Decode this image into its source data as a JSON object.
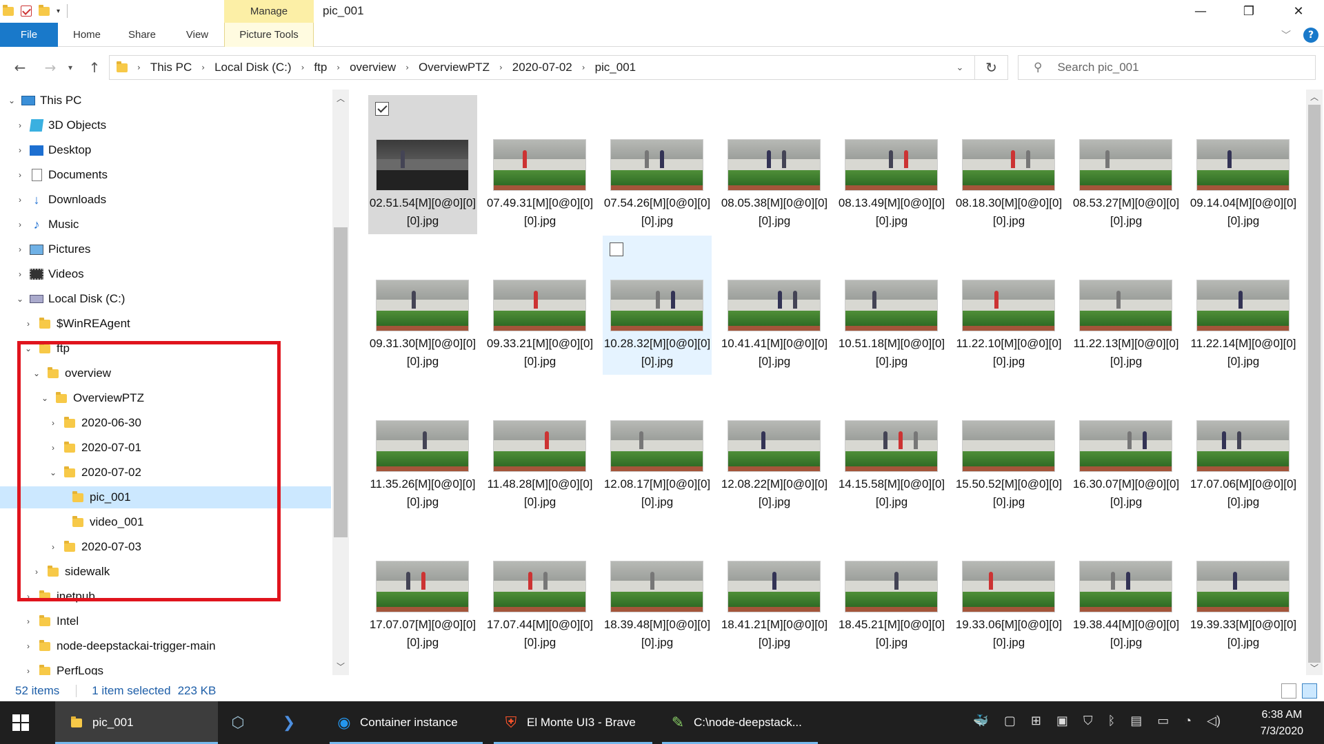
{
  "window": {
    "title": "pic_001",
    "manage_tab": "Manage",
    "tabs": [
      "File",
      "Home",
      "Share",
      "View",
      "Picture Tools"
    ],
    "help": "?"
  },
  "address": {
    "segments": [
      "This PC",
      "Local Disk (C:)",
      "ftp",
      "overview",
      "OverviewPTZ",
      "2020-07-02",
      "pic_001"
    ]
  },
  "search": {
    "placeholder": "Search pic_001"
  },
  "tree": [
    {
      "label": "This PC",
      "icon": "computer-icon",
      "indent": 0,
      "expand": "open"
    },
    {
      "label": "3D Objects",
      "icon": "cube-icon",
      "indent": 1,
      "expand": "closed"
    },
    {
      "label": "Desktop",
      "icon": "desktop-icon",
      "indent": 1,
      "expand": "closed"
    },
    {
      "label": "Documents",
      "icon": "document-icon",
      "indent": 1,
      "expand": "closed"
    },
    {
      "label": "Downloads",
      "icon": "download-icon",
      "indent": 1,
      "expand": "closed"
    },
    {
      "label": "Music",
      "icon": "music-icon",
      "indent": 1,
      "expand": "closed"
    },
    {
      "label": "Pictures",
      "icon": "pictures-icon",
      "indent": 1,
      "expand": "closed"
    },
    {
      "label": "Videos",
      "icon": "videos-icon",
      "indent": 1,
      "expand": "closed"
    },
    {
      "label": "Local Disk (C:)",
      "icon": "disk-icon",
      "indent": 1,
      "expand": "open"
    },
    {
      "label": "$WinREAgent",
      "icon": "folder-icon",
      "indent": 2,
      "expand": "closed"
    },
    {
      "label": "ftp",
      "icon": "folder-icon",
      "indent": 2,
      "expand": "open"
    },
    {
      "label": "overview",
      "icon": "folder-icon",
      "indent": 3,
      "expand": "open"
    },
    {
      "label": "OverviewPTZ",
      "icon": "folder-icon",
      "indent": 4,
      "expand": "open"
    },
    {
      "label": "2020-06-30",
      "icon": "folder-icon",
      "indent": 5,
      "expand": "closed"
    },
    {
      "label": "2020-07-01",
      "icon": "folder-icon",
      "indent": 5,
      "expand": "closed"
    },
    {
      "label": "2020-07-02",
      "icon": "folder-icon",
      "indent": 5,
      "expand": "open"
    },
    {
      "label": "pic_001",
      "icon": "folder-icon",
      "indent": 6,
      "expand": "none",
      "selected": true
    },
    {
      "label": "video_001",
      "icon": "folder-icon",
      "indent": 6,
      "expand": "none"
    },
    {
      "label": "2020-07-03",
      "icon": "folder-icon",
      "indent": 5,
      "expand": "closed"
    },
    {
      "label": "sidewalk",
      "icon": "folder-icon",
      "indent": 3,
      "expand": "closed"
    },
    {
      "label": "inetpub",
      "icon": "folder-icon",
      "indent": 2,
      "expand": "closed"
    },
    {
      "label": "Intel",
      "icon": "folder-icon",
      "indent": 2,
      "expand": "closed"
    },
    {
      "label": "node-deepstackai-trigger-main",
      "icon": "folder-icon",
      "indent": 2,
      "expand": "closed"
    },
    {
      "label": "PerfLogs",
      "icon": "folder-icon",
      "indent": 2,
      "expand": "closed"
    }
  ],
  "files": [
    {
      "name": "02.51.54[M][0@0][0][0].jpg",
      "state": "selected",
      "night": true,
      "figs": 1
    },
    {
      "name": "07.49.31[M][0@0][0][0].jpg",
      "figs": 1
    },
    {
      "name": "07.54.26[M][0@0][0][0].jpg",
      "figs": 2
    },
    {
      "name": "08.05.38[M][0@0][0][0].jpg",
      "figs": 2
    },
    {
      "name": "08.13.49[M][0@0][0][0].jpg",
      "figs": 2
    },
    {
      "name": "08.18.30[M][0@0][0][0].jpg",
      "figs": 2
    },
    {
      "name": "08.53.27[M][0@0][0][0].jpg",
      "figs": 1
    },
    {
      "name": "09.14.04[M][0@0][0][0].jpg",
      "figs": 1
    },
    {
      "name": "09.31.30[M][0@0][0][0].jpg",
      "figs": 1
    },
    {
      "name": "09.33.21[M][0@0][0][0].jpg",
      "figs": 1
    },
    {
      "name": "10.28.32[M][0@0][0][0].jpg",
      "state": "hover",
      "figs": 2
    },
    {
      "name": "10.41.41[M][0@0][0][0].jpg",
      "figs": 2
    },
    {
      "name": "10.51.18[M][0@0][0][0].jpg",
      "figs": 1
    },
    {
      "name": "11.22.10[M][0@0][0][0].jpg",
      "figs": 1
    },
    {
      "name": "11.22.13[M][0@0][0][0].jpg",
      "figs": 1
    },
    {
      "name": "11.22.14[M][0@0][0][0].jpg",
      "figs": 1
    },
    {
      "name": "11.35.26[M][0@0][0][0].jpg",
      "figs": 1
    },
    {
      "name": "11.48.28[M][0@0][0][0].jpg",
      "figs": 1
    },
    {
      "name": "12.08.17[M][0@0][0][0].jpg",
      "figs": 1
    },
    {
      "name": "12.08.22[M][0@0][0][0].jpg",
      "figs": 1
    },
    {
      "name": "14.15.58[M][0@0][0][0].jpg",
      "figs": 3
    },
    {
      "name": "15.50.52[M][0@0][0][0].jpg",
      "figs": 0
    },
    {
      "name": "16.30.07[M][0@0][0][0].jpg",
      "figs": 2
    },
    {
      "name": "17.07.06[M][0@0][0][0].jpg",
      "figs": 2
    },
    {
      "name": "17.07.07[M][0@0][0][0].jpg",
      "figs": 2
    },
    {
      "name": "17.07.44[M][0@0][0][0].jpg",
      "figs": 2
    },
    {
      "name": "18.39.48[M][0@0][0][0].jpg",
      "figs": 1
    },
    {
      "name": "18.41.21[M][0@0][0][0].jpg",
      "figs": 1
    },
    {
      "name": "18.45.21[M][0@0][0][0].jpg",
      "figs": 1
    },
    {
      "name": "19.33.06[M][0@0][0][0].jpg",
      "figs": 1
    },
    {
      "name": "19.38.44[M][0@0][0][0].jpg",
      "figs": 2
    },
    {
      "name": "19.39.33[M][0@0][0][0].jpg",
      "figs": 1
    }
  ],
  "status": {
    "items": "52 items",
    "selected": "1 item selected",
    "size": "223 KB"
  },
  "taskbar": {
    "items": [
      {
        "label": "pic_001",
        "icon": "folder-icon",
        "state": "active"
      },
      {
        "label": "",
        "icon": "virtualbox-icon",
        "state": ""
      },
      {
        "label": "",
        "icon": "powershell-icon",
        "state": ""
      },
      {
        "label": "Container instance",
        "icon": "docker-icon",
        "state": "open"
      },
      {
        "label": "El Monte UI3 - Brave",
        "icon": "brave-icon",
        "state": "open"
      },
      {
        "label": "C:\\node-deepstack...",
        "icon": "notepad-icon",
        "state": "open"
      }
    ],
    "time": "6:38 AM",
    "date": "7/3/2020"
  },
  "colors": {
    "accent": "#1979ca",
    "manage_tab": "#fcefa6",
    "selection": "#cce8ff",
    "highlight_box": "#e0141d"
  }
}
